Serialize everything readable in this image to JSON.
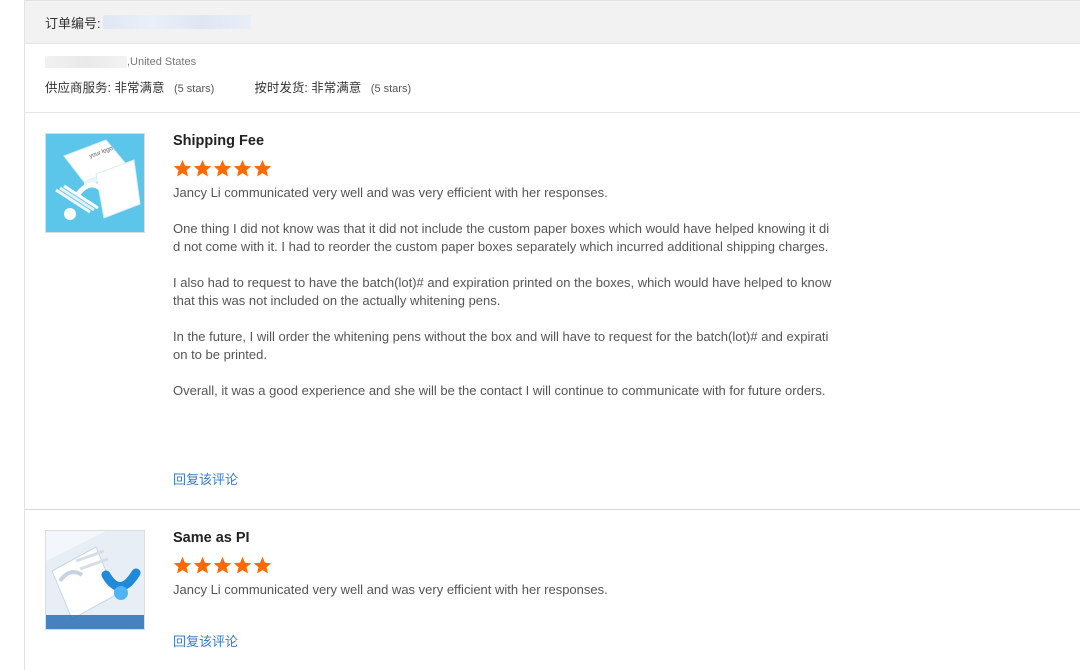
{
  "order": {
    "label": "订单编号:"
  },
  "buyer": {
    "location": ",United States"
  },
  "ratings": [
    {
      "label": "供应商服务:",
      "value": "非常满意",
      "note": "(5 stars)"
    },
    {
      "label": "按时发货:",
      "value": "非常满意",
      "note": "(5 stars)"
    }
  ],
  "reviews": [
    {
      "title": "Shipping Fee",
      "stars": 5,
      "text": "Jancy Li communicated very well and was very efficient with her responses.\n\nOne thing I did not know was that it did not include the custom paper boxes which would have helped knowing it did not come with it.  I had to reorder the custom paper boxes separately which incurred additional shipping charges.\n\nI also had to request to have the batch(lot)# and expiration printed on the boxes, which would have helped to know that this was not included on the actually whitening pens.\n\nIn the future, I will order the whitening pens without the box and will have to request for the batch(lot)# and expiration to be printed.\n\nOverall, it was a good experience and she will be the contact I will continue to communicate with for future orders.",
      "reply": "回复该评论"
    },
    {
      "title": "Same as PI",
      "stars": 5,
      "text": "Jancy Li communicated very well and was very efficient with her responses.",
      "reply": "回复该评论"
    }
  ],
  "colors": {
    "star": "#ff6a00",
    "link": "#3a7bc8",
    "header_bg": "#f2f2f2"
  },
  "icons": {
    "rating": "star-icon"
  }
}
